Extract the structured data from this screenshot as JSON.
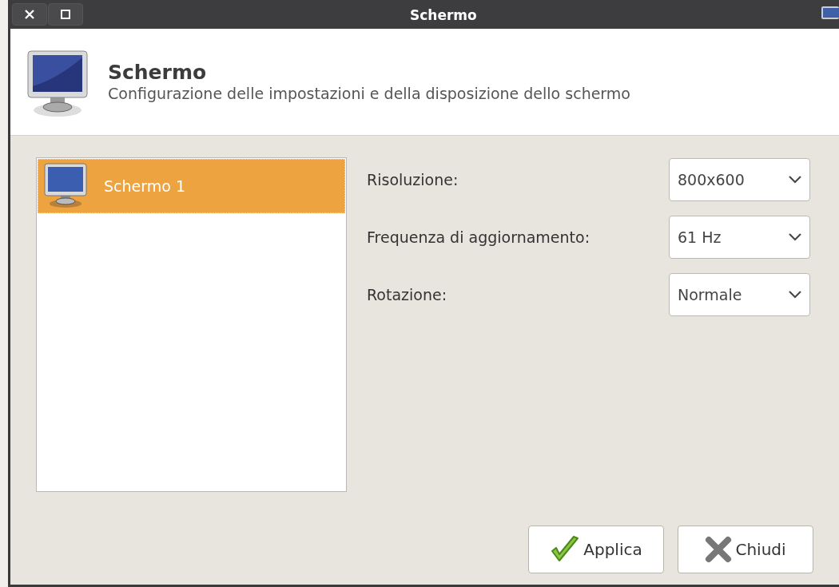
{
  "window": {
    "title": "Schermo"
  },
  "header": {
    "title": "Schermo",
    "subtitle": "Configurazione delle impostazioni e della disposizione dello schermo"
  },
  "displays": [
    {
      "label": "Schermo 1",
      "selected": true
    }
  ],
  "settings": [
    {
      "label": "Risoluzione:",
      "value": "800x600"
    },
    {
      "label": "Frequenza di aggiornamento:",
      "value": "61 Hz"
    },
    {
      "label": "Rotazione:",
      "value": "Normale"
    }
  ],
  "buttons": [
    {
      "kind": "apply",
      "label": "Applica"
    },
    {
      "kind": "close",
      "label": "Chiudi"
    }
  ]
}
